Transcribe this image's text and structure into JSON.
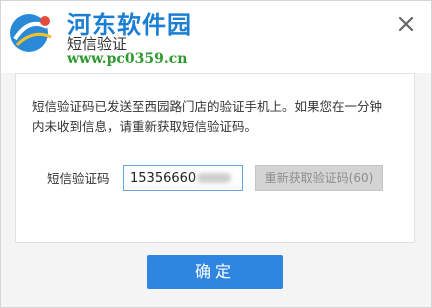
{
  "watermark": {
    "site_name": "河东软件园",
    "url": "www.pc0359.cn"
  },
  "dialog": {
    "title": "短信验证",
    "message": "短信验证码已发送至西园路门店的验证手机上。如果您在一分钟内未收到信息，请重新获取短信验证码。",
    "code_label": "短信验证码",
    "code_value": "15356660",
    "resend_label": "重新获取验证码(60)",
    "confirm_label": "确定"
  },
  "colors": {
    "accent": "#2f86e0",
    "watermark_blue": "#1a7fd2",
    "watermark_green": "#2e9a2e",
    "disabled_bg": "#d4d4d4"
  },
  "icons": {
    "logo": "pc0359-logo-icon",
    "close": "close-icon"
  }
}
